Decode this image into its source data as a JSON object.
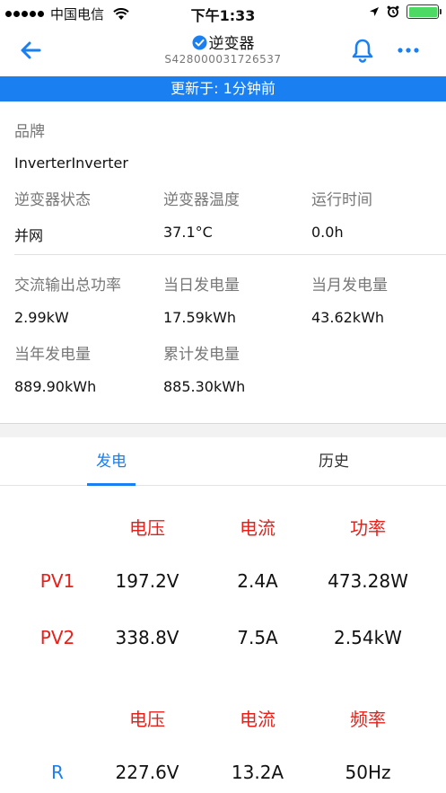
{
  "status_bar": {
    "carrier": "中国电信",
    "time": "下午1:33"
  },
  "nav": {
    "title": "逆变器",
    "serial": "S428000031726537"
  },
  "banner": {
    "text": "更新于: 1分钟前"
  },
  "info": {
    "brand_label": "品牌",
    "brand_value": "InverterInverter",
    "status_label": "逆变器状态",
    "status_value": "并网",
    "temp_label": "逆变器温度",
    "temp_value": "37.1°C",
    "runtime_label": "运行时间",
    "runtime_value": "0.0h",
    "ac_power_label": "交流输出总功率",
    "ac_power_value": "2.99kW",
    "day_energy_label": "当日发电量",
    "day_energy_value": "17.59kWh",
    "month_energy_label": "当月发电量",
    "month_energy_value": "43.62kWh",
    "year_energy_label": "当年发电量",
    "year_energy_value": "889.90kWh",
    "total_energy_label": "累计发电量",
    "total_energy_value": "885.30kWh"
  },
  "tabs": {
    "generation": "发电",
    "history": "历史"
  },
  "dc_table": {
    "headers": [
      "电压",
      "电流",
      "功率"
    ],
    "rows": [
      {
        "name": "PV1",
        "voltage": "197.2V",
        "current": "2.4A",
        "power": "473.28W"
      },
      {
        "name": "PV2",
        "voltage": "338.8V",
        "current": "7.5A",
        "power": "2.54kW"
      }
    ]
  },
  "ac_table": {
    "headers": [
      "电压",
      "电流",
      "频率"
    ],
    "rows": [
      {
        "name": "R",
        "voltage": "227.6V",
        "current": "13.2A",
        "frequency": "50Hz"
      }
    ]
  },
  "colors": {
    "accent": "#1a7ff0",
    "header_red": "#e8201a",
    "battery_green": "#4cd964"
  },
  "icons": [
    "signal-dots-icon",
    "wifi-icon",
    "location-arrow-icon",
    "alarm-icon",
    "battery-icon",
    "back-arrow-icon",
    "verified-check-icon",
    "bell-icon",
    "more-dots-icon"
  ]
}
